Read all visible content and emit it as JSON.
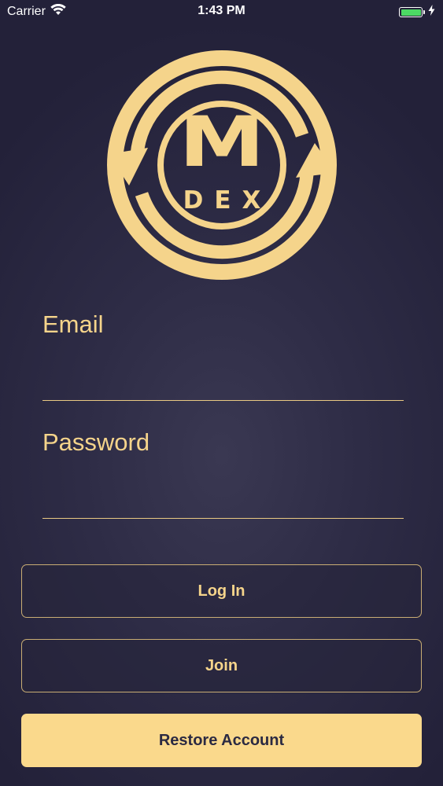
{
  "status_bar": {
    "carrier": "Carrier",
    "time": "1:43 PM"
  },
  "logo": {
    "letter": "M",
    "word": "DEX"
  },
  "form": {
    "email_label": "Email",
    "email_value": "",
    "password_label": "Password",
    "password_value": ""
  },
  "buttons": {
    "login_label": "Log In",
    "join_label": "Join",
    "restore_label": "Restore Account"
  },
  "colors": {
    "accent_gold": "#f5d48b",
    "background": "#2e2c46",
    "battery_green": "#4cd964"
  }
}
